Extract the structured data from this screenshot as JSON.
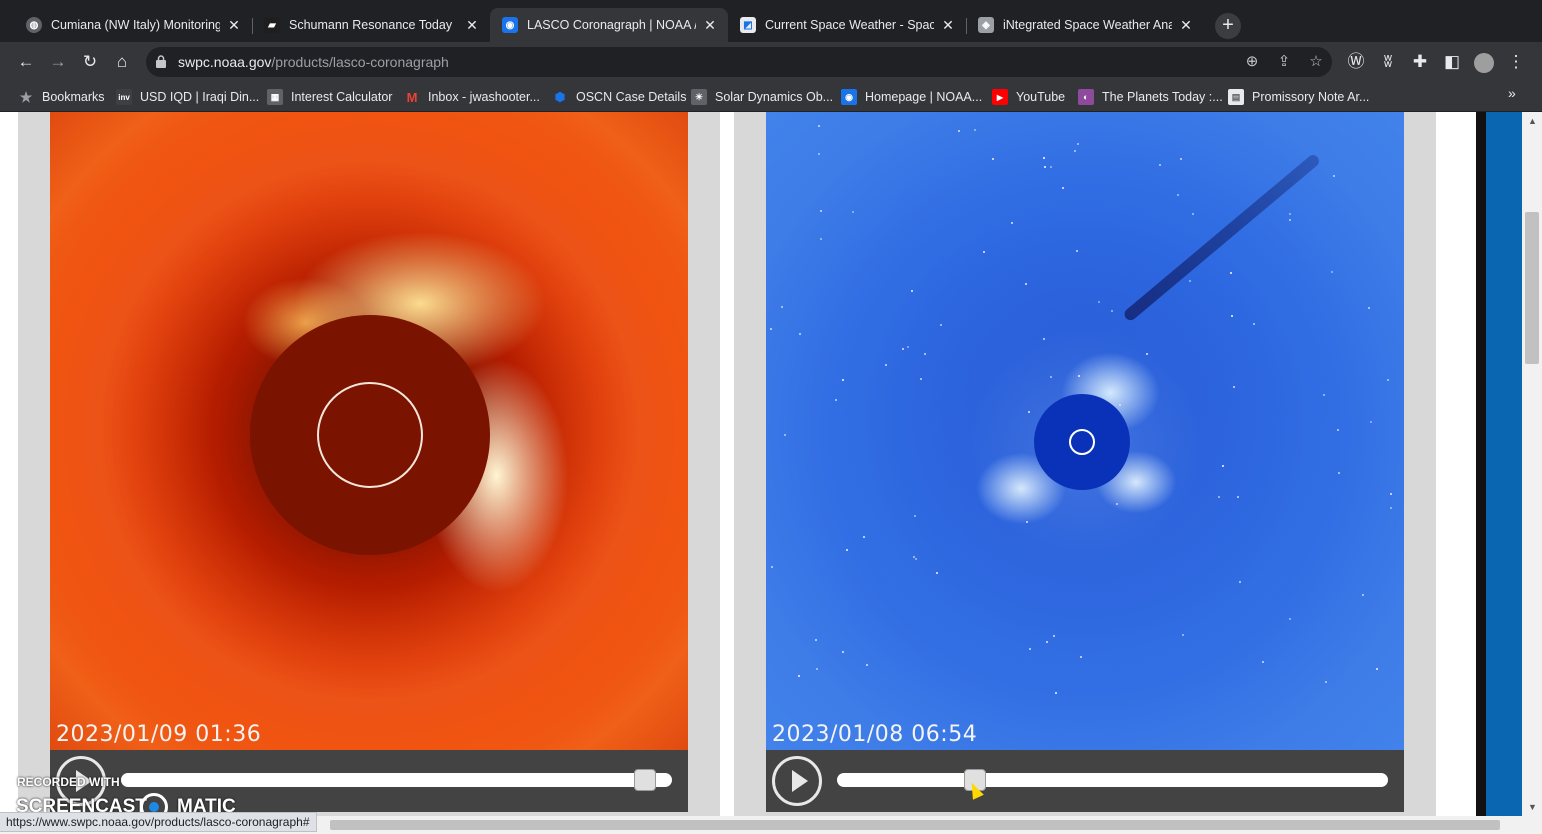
{
  "tabs": [
    {
      "title": "Cumiana (NW Italy) Monitoring S",
      "favicon": "globe-icon",
      "active": false
    },
    {
      "title": "Schumann Resonance Today ⚡",
      "favicon": "schumann-icon",
      "active": false
    },
    {
      "title": "LASCO Coronagraph | NOAA / N",
      "favicon": "noaa-icon",
      "active": true
    },
    {
      "title": "Current Space Weather - Space V",
      "favicon": "chart-icon",
      "active": false
    },
    {
      "title": "iNtegrated Space Weather Analy",
      "favicon": "isw-icon",
      "active": false
    }
  ],
  "url": {
    "host": "swpc.noaa.gov",
    "path": "/products/lasco-coronagraph"
  },
  "bookmarks": [
    {
      "label": "Bookmarks",
      "icon": "star-icon",
      "color": "#8ab4f8"
    },
    {
      "label": "USD IQD | Iraqi Din...",
      "icon": "investing-icon",
      "color": "#3c4043"
    },
    {
      "label": "Interest Calculator",
      "icon": "calculator-icon",
      "color": "#5f6368"
    },
    {
      "label": "Inbox - jwashooter...",
      "icon": "gmail-icon",
      "color": "#ea4335"
    },
    {
      "label": "OSCN Case Details",
      "icon": "oscn-icon",
      "color": "#1a73e8"
    },
    {
      "label": "Solar Dynamics Ob...",
      "icon": "sdo-icon",
      "color": "#5f6368"
    },
    {
      "label": "Homepage | NOAA...",
      "icon": "noaa-icon",
      "color": "#1a73e8"
    },
    {
      "label": "YouTube",
      "icon": "youtube-icon",
      "color": "#ff0000"
    },
    {
      "label": "The Planets Today :...",
      "icon": "planets-icon",
      "color": "#8e4b9b"
    },
    {
      "label": "Promissory Note Ar...",
      "icon": "document-icon",
      "color": "#5f6368"
    }
  ],
  "bookmarks_overflow": "»",
  "panels": [
    {
      "name": "c2",
      "timestamp": "2023/01/09 01:36",
      "position": 0.97
    },
    {
      "name": "c3",
      "timestamp": "2023/01/08 06:54",
      "position": 0.24
    }
  ],
  "watermark": {
    "recorded": "RECORDED WITH",
    "brand_left": "SCREENCAST",
    "brand_right": "MATIC"
  },
  "status_url": "https://www.swpc.noaa.gov/products/lasco-coronagraph#"
}
